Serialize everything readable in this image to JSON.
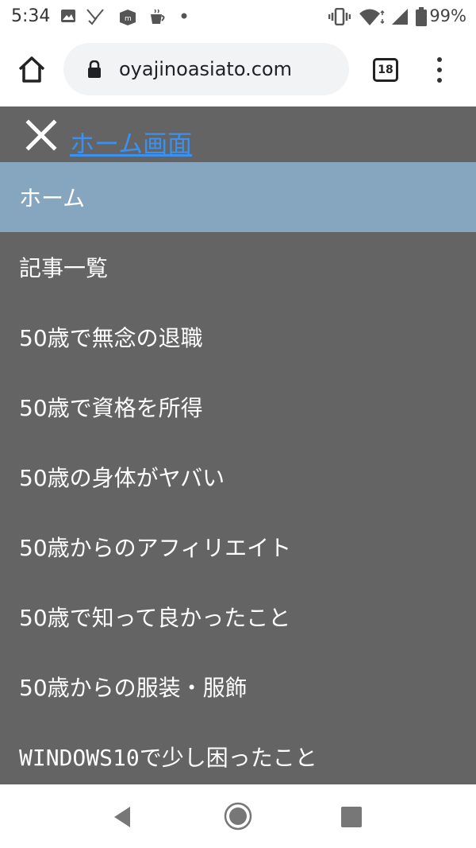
{
  "status_bar": {
    "time": "5:34",
    "battery": "99%",
    "icons": [
      "image-icon",
      "signal-check-icon",
      "app-icon",
      "coffee-icon",
      "dot-icon",
      "vibrate-icon",
      "wifi-icon",
      "cell-signal-icon",
      "battery-icon"
    ]
  },
  "browser": {
    "url": "oyajinoasiato.com",
    "tab_count": "18"
  },
  "nav": {
    "home_link": "ホーム画面",
    "items": [
      {
        "label": "ホーム",
        "active": true
      },
      {
        "label": "記事一覧"
      },
      {
        "label": "50歳で無念の退職"
      },
      {
        "label": "50歳で資格を所得"
      },
      {
        "label": "50歳の身体がヤバい"
      },
      {
        "label": "50歳からのアフィリエイト"
      },
      {
        "label": "50歳で知って良かったこと"
      },
      {
        "label": "50歳からの服装・服飾"
      },
      {
        "label": "WINDOWS10で少し困ったこと"
      }
    ]
  },
  "colors": {
    "panel_bg": "#646464",
    "active_item_bg": "#86a6c0",
    "link": "#3b91f0"
  }
}
